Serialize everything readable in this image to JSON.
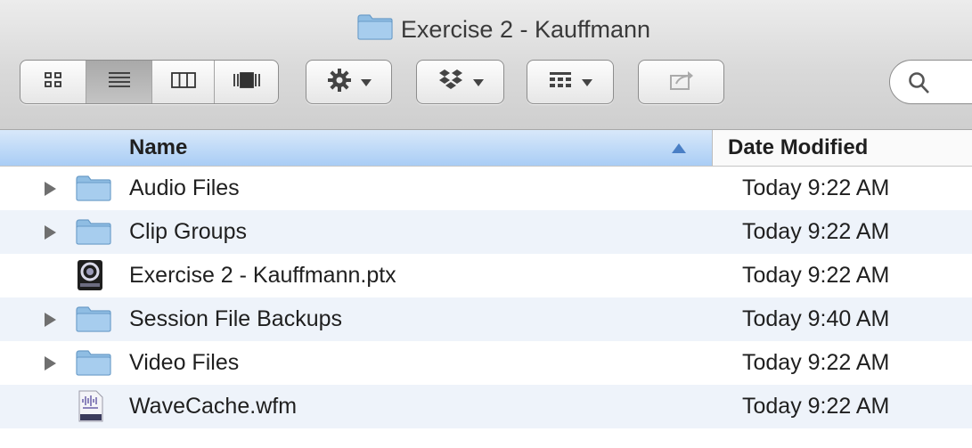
{
  "window": {
    "title": "Exercise 2 - Kauffmann",
    "title_icon": "folder-icon"
  },
  "toolbar": {
    "view_modes": [
      {
        "name": "icon-view",
        "icon": "icon-grid-icon",
        "active": false
      },
      {
        "name": "list-view",
        "icon": "list-lines-icon",
        "active": true
      },
      {
        "name": "column-view",
        "icon": "columns-icon",
        "active": false
      },
      {
        "name": "cover-flow-view",
        "icon": "cover-flow-icon",
        "active": false
      }
    ],
    "action_icon": "gear-icon",
    "dropbox_icon": "dropbox-icon",
    "arrange_icon": "arrange-grid-icon",
    "share_icon": "share-icon",
    "search_icon": "magnifier-icon"
  },
  "columns": {
    "name": "Name",
    "date_modified": "Date Modified",
    "sort": "ascending"
  },
  "files": [
    {
      "name": "Audio Files",
      "date": "Today 9:22 AM",
      "type": "folder",
      "expandable": true
    },
    {
      "name": "Clip Groups",
      "date": "Today 9:22 AM",
      "type": "folder",
      "expandable": true
    },
    {
      "name": "Exercise 2 - Kauffmann.ptx",
      "date": "Today 9:22 AM",
      "type": "protools-session",
      "expandable": false
    },
    {
      "name": "Session File Backups",
      "date": "Today 9:40 AM",
      "type": "folder",
      "expandable": true
    },
    {
      "name": "Video Files",
      "date": "Today 9:22 AM",
      "type": "folder",
      "expandable": true
    },
    {
      "name": "WaveCache.wfm",
      "date": "Today 9:22 AM",
      "type": "waveform-cache",
      "expandable": false
    }
  ],
  "colors": {
    "header_highlight": "#a9cdf5",
    "folder_blue": "#8fbde3",
    "row_stripe": "#eef3fa"
  }
}
